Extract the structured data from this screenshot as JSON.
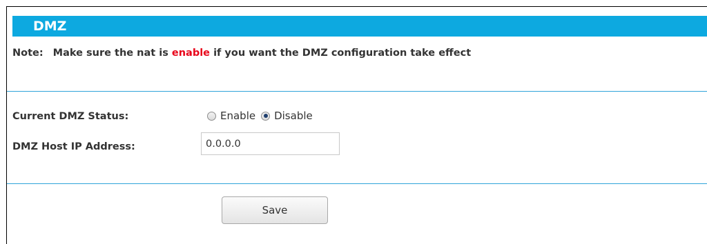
{
  "page": {
    "title": "DMZ"
  },
  "note": {
    "prefix": "Note:",
    "text_before": "Make sure the nat is ",
    "highlight": "enable",
    "text_after": " if you want the DMZ configuration take effect",
    "highlight_color": "#e8061b"
  },
  "status": {
    "label": "Current DMZ Status:",
    "options": [
      {
        "label": "Enable",
        "checked": false
      },
      {
        "label": "Disable",
        "checked": true
      }
    ]
  },
  "host_ip": {
    "label": "DMZ Host IP Address:",
    "value": "0.0.0.0"
  },
  "actions": {
    "save_label": "Save"
  },
  "colors": {
    "title_bar": "#0da9e0",
    "divider": "#2ea3d9"
  }
}
